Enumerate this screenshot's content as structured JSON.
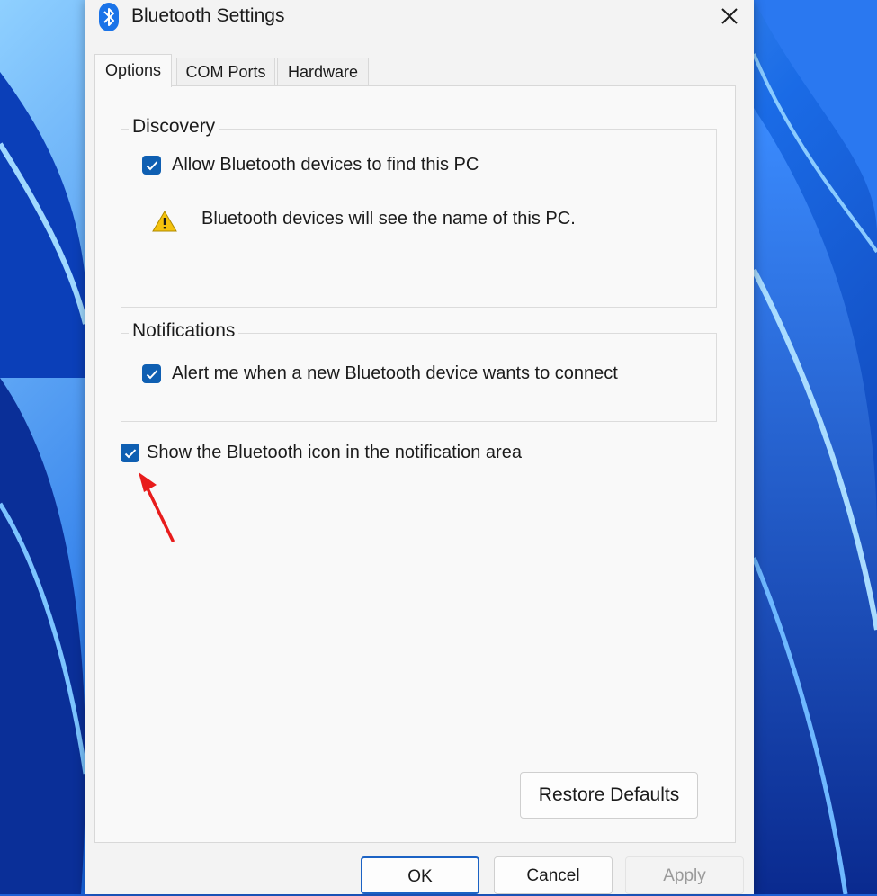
{
  "window": {
    "title": "Bluetooth Settings",
    "close_icon": "close-icon",
    "app_icon": "bluetooth-icon"
  },
  "tabs": [
    {
      "label": "Options",
      "active": true
    },
    {
      "label": "COM Ports",
      "active": false
    },
    {
      "label": "Hardware",
      "active": false
    }
  ],
  "discovery": {
    "heading": "Discovery",
    "allow_label": "Allow Bluetooth devices to find this PC",
    "allow_checked": true,
    "warning_text": "Bluetooth devices will see the name of this PC."
  },
  "notifications": {
    "heading": "Notifications",
    "alert_label": "Alert me when a new Bluetooth device wants to connect",
    "alert_checked": true
  },
  "show_icon": {
    "label": "Show the Bluetooth icon in the notification area",
    "checked": true
  },
  "buttons": {
    "restore_defaults": "Restore Defaults",
    "ok": "OK",
    "cancel": "Cancel",
    "apply": "Apply"
  },
  "colors": {
    "accent": "#0f5fb2",
    "annotation_arrow": "#e81c1c",
    "warning": "#f4c20d"
  }
}
